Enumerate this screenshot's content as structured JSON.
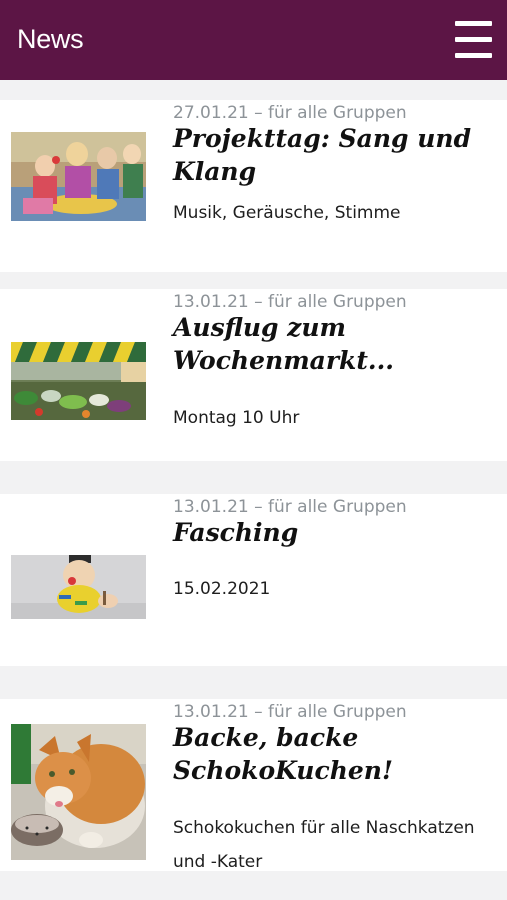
{
  "header": {
    "title": "News",
    "menu_icon": "hamburger-menu-icon"
  },
  "posts": [
    {
      "meta": "27.01.21 – für alle Gruppen",
      "title": "Projekttag: Sang und Klang",
      "excerpt": "Musik, Geräusche, Stimme"
    },
    {
      "meta": "13.01.21 – für alle Gruppen",
      "title": "Ausflug zum Wochenmarkt...",
      "excerpt": "Montag 10 Uhr"
    },
    {
      "meta": "13.01.21 – für alle Gruppen",
      "title": "Fasching",
      "excerpt": "15.02.2021"
    },
    {
      "meta": "13.01.21 – für alle Gruppen",
      "title": "Backe, backe SchokoKuchen!",
      "excerpt": "Schokokuchen für alle  Naschkatzen und -Kater"
    }
  ],
  "colors": {
    "header_bg": "#5c1545",
    "page_bg": "#f2f2f3",
    "meta_text": "#8d9398"
  }
}
